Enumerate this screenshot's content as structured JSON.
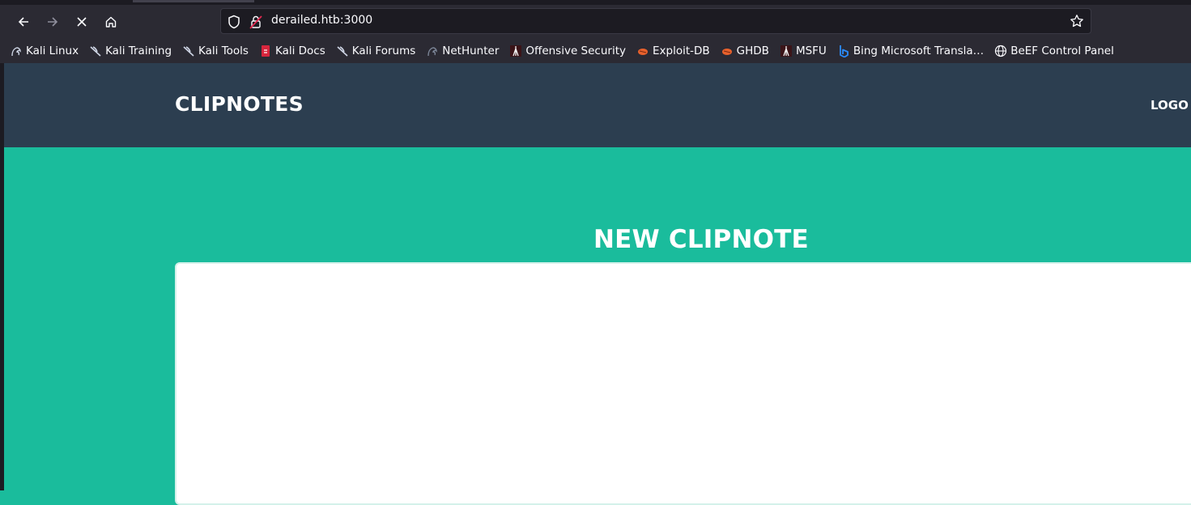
{
  "browser": {
    "url": "derailed.htb:3000",
    "bookmarks": [
      {
        "label": "Kali Linux",
        "icon": "kali-dragon-icon"
      },
      {
        "label": "Kali Training",
        "icon": "kali-dragon-icon"
      },
      {
        "label": "Kali Tools",
        "icon": "kali-dragon-icon"
      },
      {
        "label": "Kali Docs",
        "icon": "kali-docs-icon"
      },
      {
        "label": "Kali Forums",
        "icon": "kali-dragon-icon"
      },
      {
        "label": "NetHunter",
        "icon": "kali-dragon-icon"
      },
      {
        "label": "Offensive Security",
        "icon": "offsec-icon"
      },
      {
        "label": "Exploit-DB",
        "icon": "exploit-db-icon"
      },
      {
        "label": "GHDB",
        "icon": "exploit-db-icon"
      },
      {
        "label": "MSFU",
        "icon": "offsec-icon"
      },
      {
        "label": "Bing Microsoft Transla…",
        "icon": "bing-icon"
      },
      {
        "label": "BeEF Control Panel",
        "icon": "globe-icon"
      }
    ]
  },
  "site": {
    "brand": "CLIPNOTES",
    "nav_link": "LOGO",
    "heading": "NEW CLIPNOTE"
  },
  "colors": {
    "navbar": "#2c3e50",
    "page_bg": "#1abc9c",
    "browser_chrome": "#2b2a33"
  }
}
